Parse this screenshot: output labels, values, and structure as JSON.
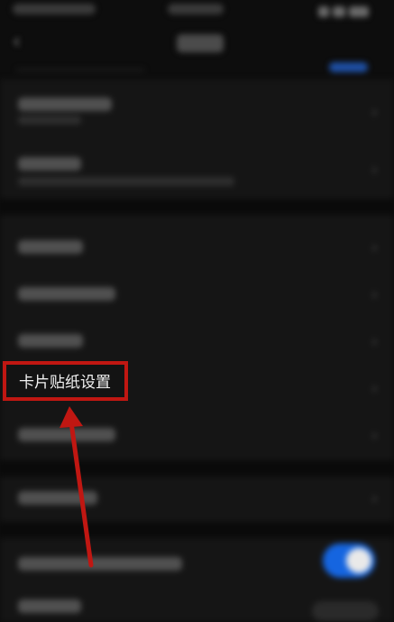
{
  "settings_list": {
    "highlighted_item": {
      "label": "卡片贴纸设置"
    }
  },
  "annotation": {
    "box_color": "#c01712",
    "arrow_color": "#c01712"
  },
  "toggle": {
    "state": "on",
    "color": "#1565e0"
  }
}
